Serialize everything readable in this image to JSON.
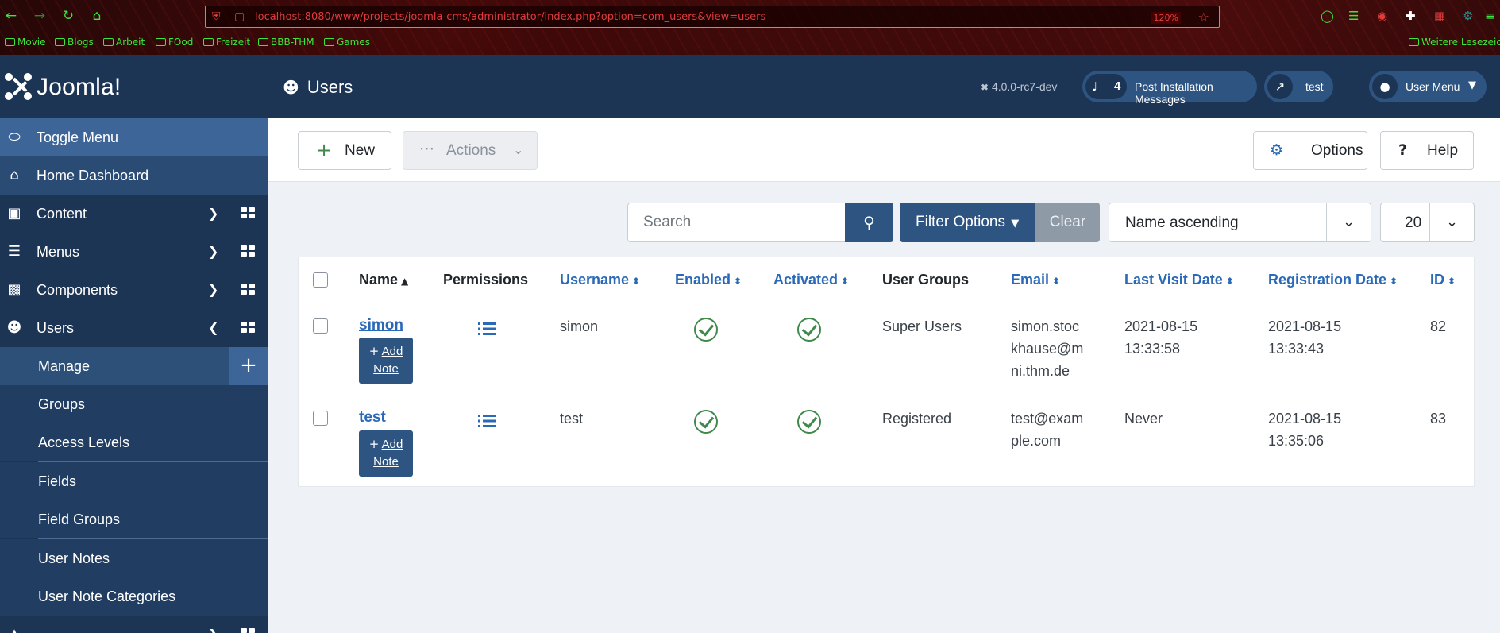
{
  "browser": {
    "url": "localhost:8080/www/projects/joomla-cms/administrator/index.php?option=com_users&view=users",
    "zoom": "120%",
    "bookmarks": [
      "Movie",
      "Blogs",
      "Arbeit",
      "FOod",
      "Freizeit",
      "BBB-THM",
      "Games"
    ],
    "other_bookmarks": "Weitere Lesezeichen"
  },
  "brand": {
    "name": "Joomla!"
  },
  "header": {
    "title": "Users",
    "version": "4.0.0-rc7-dev",
    "post_install_count": "4",
    "post_install_label": "Post Installation Messages",
    "site_label": "test",
    "user_menu_label": "User Menu"
  },
  "sidebar": {
    "toggle": "Toggle Menu",
    "home": "Home Dashboard",
    "items": [
      {
        "label": "Content"
      },
      {
        "label": "Menus"
      },
      {
        "label": "Components"
      },
      {
        "label": "Users"
      }
    ],
    "users_sub": [
      "Manage",
      "Groups",
      "Access Levels",
      "Fields",
      "Field Groups",
      "User Notes",
      "User Note Categories"
    ]
  },
  "toolbar": {
    "new_label": "New",
    "actions_label": "Actions",
    "options_label": "Options",
    "help_label": "Help"
  },
  "filters": {
    "search_placeholder": "Search",
    "filter_options_label": "Filter Options",
    "clear_label": "Clear",
    "sort_value": "Name ascending",
    "limit_value": "20"
  },
  "table": {
    "columns": {
      "name": "Name",
      "permissions": "Permissions",
      "username": "Username",
      "enabled": "Enabled",
      "activated": "Activated",
      "groups": "User Groups",
      "email": "Email",
      "last_visit": "Last Visit Date",
      "registration": "Registration Date",
      "id": "ID"
    },
    "add_note_label": "Add Note",
    "rows": [
      {
        "name": "simon",
        "username": "simon",
        "groups": "Super Users",
        "email_lines": [
          "simon.stoc",
          "khause@m",
          "ni.thm.de"
        ],
        "last_visit_lines": [
          "2021-08-15",
          "13:33:58"
        ],
        "registration_lines": [
          "2021-08-15",
          "13:33:43"
        ],
        "id": "82"
      },
      {
        "name": "test",
        "username": "test",
        "groups": "Registered",
        "email_lines": [
          "test@exam",
          "ple.com"
        ],
        "last_visit_lines": [
          "Never"
        ],
        "registration_lines": [
          "2021-08-15",
          "13:35:06"
        ],
        "id": "83"
      }
    ]
  },
  "colors": {
    "sidebar_bg": "#1c3555",
    "accent_blue": "#2e5482",
    "link_blue": "#2a69b8",
    "success_green": "#3f8a4b"
  }
}
